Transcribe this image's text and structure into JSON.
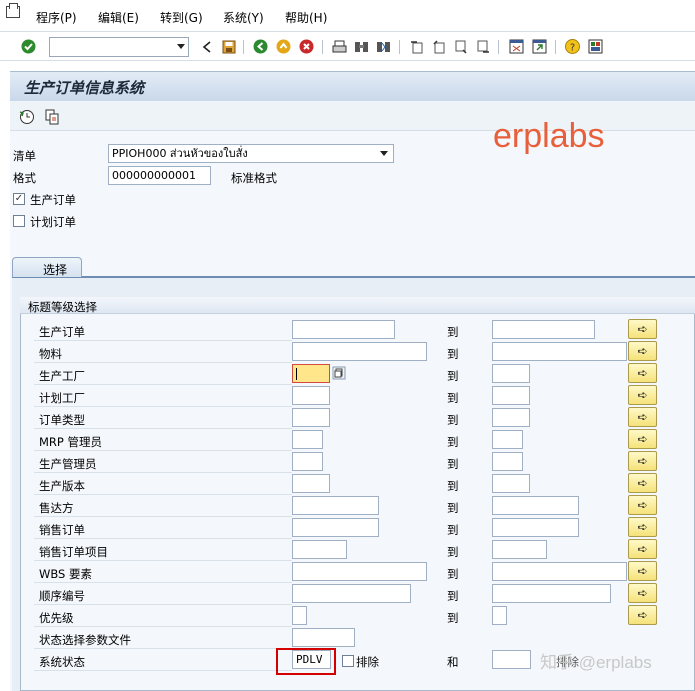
{
  "menubar": {
    "items": [
      {
        "label": "程序(P)"
      },
      {
        "label": "编辑(E)"
      },
      {
        "label": "转到(G)"
      },
      {
        "label": "系统(Y)"
      },
      {
        "label": "帮助(H)"
      }
    ]
  },
  "toolbar": {
    "command_value": "",
    "icons": [
      "check-icon",
      "back-icon",
      "save-icon",
      "green-back-icon",
      "exit-icon",
      "cancel-icon",
      "print-icon",
      "find-icon",
      "find-next-icon",
      "first-page-icon",
      "prev-page-icon",
      "next-page-icon",
      "last-page-icon",
      "new-session-icon",
      "shortcut-icon",
      "help-icon",
      "layout-icon"
    ]
  },
  "title": "生产订单信息系统",
  "header": {
    "list_label": "清单",
    "list_value": "PPIOH000 ส่วนหัวของใบสั่ง",
    "format_label": "格式",
    "format_value": "000000000001",
    "format_desc": "标准格式",
    "production_order_label": "生产订单",
    "production_order_checked": true,
    "planned_order_label": "计划订单",
    "planned_order_checked": false
  },
  "tab_label": "选择",
  "group_title": "标题等级选择",
  "to_label": "到",
  "rows": [
    {
      "label": "生产订单",
      "from": "",
      "to": ""
    },
    {
      "label": "物料",
      "from": "",
      "to": ""
    },
    {
      "label": "生产工厂",
      "from": "",
      "to": ""
    },
    {
      "label": "计划工厂",
      "from": "",
      "to": ""
    },
    {
      "label": "订单类型",
      "from": "",
      "to": ""
    },
    {
      "label": "MRP 管理员",
      "from": "",
      "to": ""
    },
    {
      "label": "生产管理员",
      "from": "",
      "to": ""
    },
    {
      "label": "生产版本",
      "from": "",
      "to": ""
    },
    {
      "label": "售达方",
      "from": "",
      "to": ""
    },
    {
      "label": "销售订单",
      "from": "",
      "to": ""
    },
    {
      "label": "销售订单项目",
      "from": "",
      "to": ""
    },
    {
      "label": "WBS 要素",
      "from": "",
      "to": ""
    },
    {
      "label": "顺序编号",
      "from": "",
      "to": ""
    },
    {
      "label": "优先级",
      "from": "",
      "to": ""
    },
    {
      "label": "状态选择参数文件",
      "from": ""
    }
  ],
  "system_status": {
    "label": "系统状态",
    "value": "PDLV",
    "exclude_label": "排除",
    "and_label": "和",
    "and_value": "",
    "exclude2_label": "排除"
  },
  "watermark": "erplabs",
  "watermark2": "知乎 @erplabs",
  "colors": {
    "title_gradient_top": "#e2ecf6",
    "exec_button": "#f5e27a",
    "highlight_field": "#ffe68a",
    "red_box": "#d40000",
    "watermark": "#e8603b"
  }
}
